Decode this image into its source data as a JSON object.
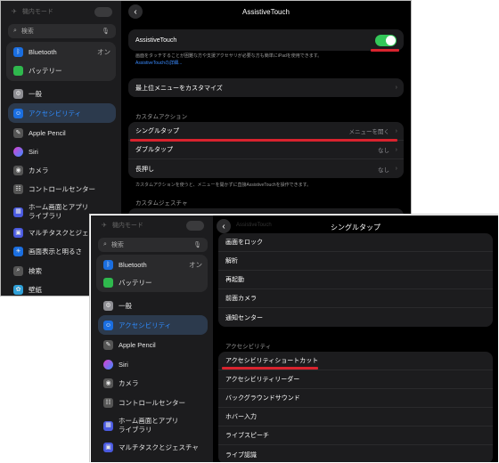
{
  "shot1": {
    "sidebar": {
      "airplane_label": "機内モード",
      "search_placeholder": "検索",
      "items": [
        {
          "label": "Bluetooth",
          "value": "オン"
        },
        {
          "label": "バッテリー"
        },
        {
          "label": "一般"
        },
        {
          "label": "アクセシビリティ"
        },
        {
          "label": "Apple Pencil"
        },
        {
          "label": "Siri"
        },
        {
          "label": "カメラ"
        },
        {
          "label": "コントロールセンター"
        },
        {
          "label": "ホーム画面とアプリライブラリ",
          "line1": "ホーム画面とアプリ",
          "line2": "ライブラリ"
        },
        {
          "label": "マルチタスクとジェスチャ"
        },
        {
          "label": "画面表示と明るさ"
        },
        {
          "label": "検索"
        },
        {
          "label": "壁紙"
        }
      ]
    },
    "main": {
      "title": "AssistiveTouch",
      "toggle_label": "AssistiveTouch",
      "toggle_note": "画面をタッチすることが困難な方や支援アクセサリが必要な方も簡単にiPadを使用できます。",
      "toggle_link": "AssistiveTouchの詳細...",
      "customize_label": "最上位メニューをカスタマイズ",
      "custom_actions_header": "カスタムアクション",
      "actions": [
        {
          "label": "シングルタップ",
          "value": "メニューを開く"
        },
        {
          "label": "ダブルタップ",
          "value": "なし"
        },
        {
          "label": "長押し",
          "value": "なし"
        }
      ],
      "actions_note": "カスタムアクションを使うと、メニューを開かずに直接AssistiveTouchを操作できます。",
      "gestures_header": "カスタムジェスチャ"
    }
  },
  "shot2": {
    "sidebar": {
      "airplane_label": "機内モード",
      "search_placeholder": "検索",
      "items": [
        {
          "label": "Bluetooth",
          "value": "オン"
        },
        {
          "label": "バッテリー"
        },
        {
          "label": "一般"
        },
        {
          "label": "アクセシビリティ"
        },
        {
          "label": "Apple Pencil"
        },
        {
          "label": "Siri"
        },
        {
          "label": "カメラ"
        },
        {
          "label": "コントロールセンター"
        },
        {
          "label": "ホーム画面とアプリライブラリ",
          "line1": "ホーム画面とアプリ",
          "line2": "ライブラリ"
        },
        {
          "label": "マルチタスクとジェスチャ"
        }
      ]
    },
    "main": {
      "title": "シングルタップ",
      "back_hint": "AssistiveTouch",
      "system_items": [
        "画面をロック",
        "解析",
        "再起動",
        "前面カメラ",
        "通知センター"
      ],
      "accessibility_header": "アクセシビリティ",
      "accessibility_items": [
        "アクセシビリティショートカット",
        "アクセシビリティリーダー",
        "バックグラウンドサウンド",
        "ホバー入力",
        "ライブスピーチ",
        "ライブ認識"
      ]
    }
  },
  "colors": {
    "accent": "#2f8cff",
    "toggle_on": "#34c759",
    "highlight": "#d9232e"
  }
}
